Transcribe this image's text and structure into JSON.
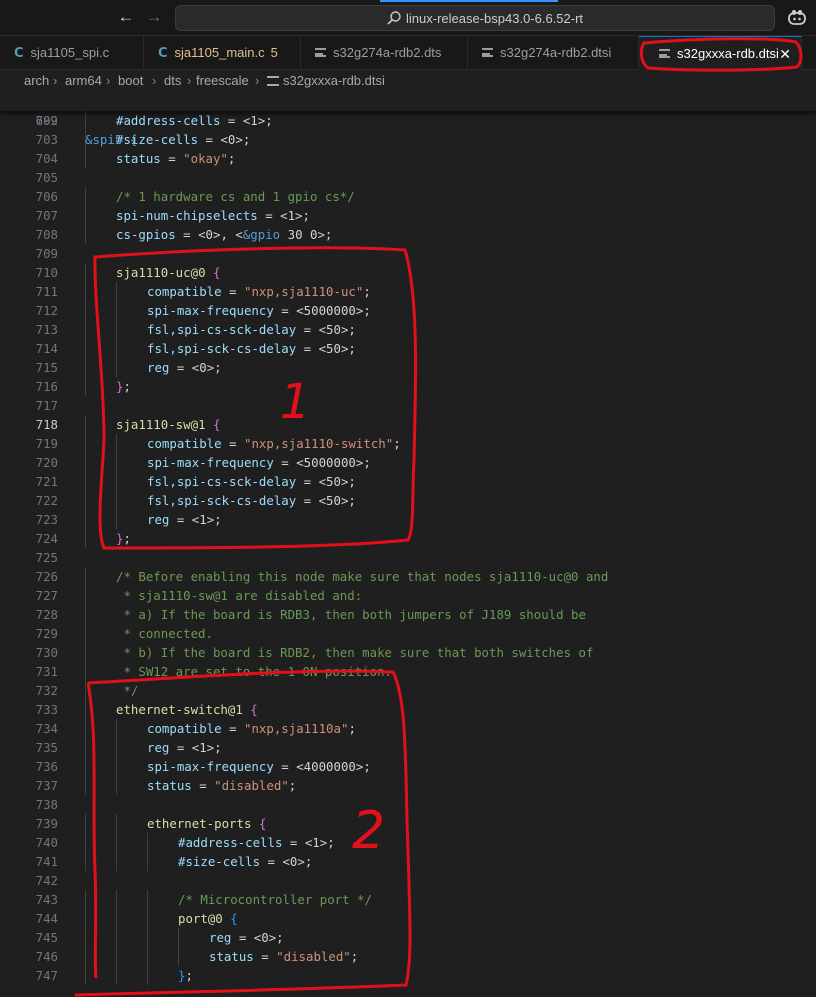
{
  "titlebar": {
    "back_icon": "arrow-left-icon",
    "forward_icon": "arrow-right-icon",
    "search_text": "linux-release-bsp43.0-6.6.52-rt",
    "copilot_icon": "copilot-icon"
  },
  "tabs": [
    {
      "label": "sja1105_spi.c",
      "icon": "c-file-icon"
    },
    {
      "label": "sja1105_main.c",
      "icon": "c-file-icon",
      "badge": "5"
    },
    {
      "label": "s32g274a-rdb2.dts",
      "icon": "lines-file-icon"
    },
    {
      "label": "s32g274a-rdb2.dtsi",
      "icon": "lines-file-icon"
    },
    {
      "label": "s32gxxxa-rdb.dtsi",
      "icon": "lines-file-icon",
      "close": "✕"
    }
  ],
  "breadcrumb": [
    "arch",
    "arm64",
    "boot",
    "dts",
    "freescale",
    "s32gxxxa-rdb.dtsi"
  ],
  "sticky_line": {
    "num": "699",
    "text": "&spi5 {"
  },
  "lines": [
    {
      "num": "702",
      "text": "#address-cells = <1>;"
    },
    {
      "num": "703",
      "text": "#size-cells = <0>;"
    },
    {
      "num": "704",
      "text": "status = \"okay\";"
    },
    {
      "num": "705",
      "text": ""
    },
    {
      "num": "706",
      "text": "/* 1 hardware cs and 1 gpio cs*/"
    },
    {
      "num": "707",
      "text": "spi-num-chipselects = <1>;"
    },
    {
      "num": "708",
      "text": "cs-gpios = <0>, <&gpio 30 0>;"
    },
    {
      "num": "709",
      "text": ""
    },
    {
      "num": "710",
      "text": "sja1110-uc@0 {"
    },
    {
      "num": "711",
      "text": "compatible = \"nxp,sja1110-uc\";"
    },
    {
      "num": "712",
      "text": "spi-max-frequency = <5000000>;"
    },
    {
      "num": "713",
      "text": "fsl,spi-cs-sck-delay = <50>;"
    },
    {
      "num": "714",
      "text": "fsl,spi-sck-cs-delay = <50>;"
    },
    {
      "num": "715",
      "text": "reg = <0>;"
    },
    {
      "num": "716",
      "text": "};"
    },
    {
      "num": "717",
      "text": ""
    },
    {
      "num": "718",
      "text": "sja1110-sw@1 {"
    },
    {
      "num": "719",
      "text": "compatible = \"nxp,sja1110-switch\";"
    },
    {
      "num": "720",
      "text": "spi-max-frequency = <5000000>;"
    },
    {
      "num": "721",
      "text": "fsl,spi-cs-sck-delay = <50>;"
    },
    {
      "num": "722",
      "text": "fsl,spi-sck-cs-delay = <50>;"
    },
    {
      "num": "723",
      "text": "reg = <1>;"
    },
    {
      "num": "724",
      "text": "};"
    },
    {
      "num": "725",
      "text": ""
    },
    {
      "num": "726",
      "text": "/* Before enabling this node make sure that nodes sja1110-uc@0 and"
    },
    {
      "num": "727",
      "text": " * sja1110-sw@1 are disabled and:"
    },
    {
      "num": "728",
      "text": " * a) If the board is RDB3, then both jumpers of J189 should be"
    },
    {
      "num": "729",
      "text": " * connected."
    },
    {
      "num": "730",
      "text": " * b) If the board is RDB2, then make sure that both switches of"
    },
    {
      "num": "731",
      "text": " * SW12 are set to the 1-ON position."
    },
    {
      "num": "732",
      "text": " */"
    },
    {
      "num": "733",
      "text": "ethernet-switch@1 {"
    },
    {
      "num": "734",
      "text": "compatible = \"nxp,sja1110a\";"
    },
    {
      "num": "735",
      "text": "reg = <1>;"
    },
    {
      "num": "736",
      "text": "spi-max-frequency = <4000000>;"
    },
    {
      "num": "737",
      "text": "status = \"disabled\";"
    },
    {
      "num": "738",
      "text": ""
    },
    {
      "num": "739",
      "text": "ethernet-ports {"
    },
    {
      "num": "740",
      "text": "#address-cells = <1>;"
    },
    {
      "num": "741",
      "text": "#size-cells = <0>;"
    },
    {
      "num": "742",
      "text": ""
    },
    {
      "num": "743",
      "text": "/* Microcontroller port */"
    },
    {
      "num": "744",
      "text": "port@0 {"
    },
    {
      "num": "745",
      "text": "reg = <0>;"
    },
    {
      "num": "746",
      "text": "status = \"disabled\";"
    },
    {
      "num": "747",
      "text": "};"
    }
  ],
  "annotations": {
    "label_1": "1",
    "label_2": "2",
    "color": "#e3101c"
  },
  "colors": {
    "property": "#9cdcfe",
    "string": "#ce9178",
    "comment": "#6a9955",
    "node": "#dcdcaa",
    "bracket_gold": "#ffd700",
    "bracket_purple": "#da70d6",
    "bracket_blue": "#179fff"
  }
}
